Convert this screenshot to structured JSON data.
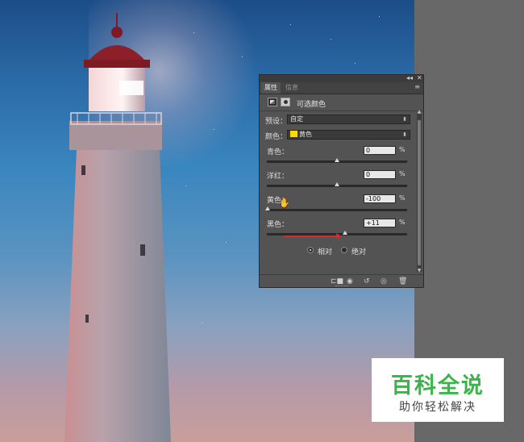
{
  "panel": {
    "tabs": [
      {
        "label": "属性",
        "active": true
      },
      {
        "label": "信息",
        "active": false
      }
    ],
    "window_controls": {
      "collapse": "◂◂",
      "close": "✕",
      "menu": "≡"
    },
    "header_title": "可选颜色",
    "preset": {
      "label": "预设：",
      "value": "自定"
    },
    "color": {
      "label": "颜色：",
      "value": "黄色",
      "swatch_color": "#ffd800"
    },
    "sliders": [
      {
        "label": "青色：",
        "value": "0",
        "unit": "%",
        "position": 0.5
      },
      {
        "label": "洋红：",
        "value": "0",
        "unit": "%",
        "position": 0.5
      },
      {
        "label": "黄色：",
        "value": "-100",
        "unit": "%",
        "position": 0.0
      },
      {
        "label": "黑色：",
        "value": "+11",
        "unit": "%",
        "position": 0.555
      }
    ],
    "method": {
      "options": [
        {
          "label": "相对",
          "checked": true
        },
        {
          "label": "绝对",
          "checked": false
        }
      ]
    },
    "bottom_icons": [
      "clip-to-layer-icon",
      "view-previous-icon",
      "reset-icon",
      "visibility-eye-icon",
      "trash-icon"
    ]
  },
  "annotation": {
    "arrow_color": "#d42c2c"
  },
  "watermark": {
    "title": "百科全说",
    "subtitle": "助你轻松解决",
    "title_color": "#3bb54a"
  }
}
